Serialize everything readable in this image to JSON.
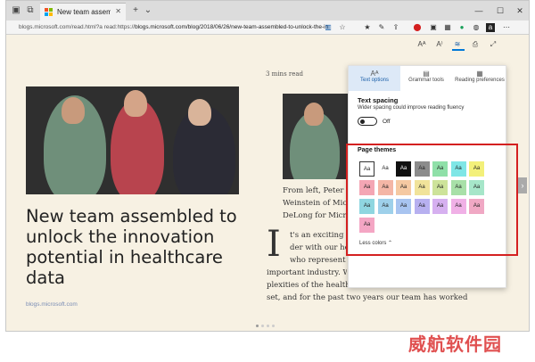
{
  "tab": {
    "title": "New team assembled to unlock"
  },
  "address": {
    "url_prefix": "blogs.microsoft.com/read.html?a",
    "read_label": "read:https://",
    "url_main": "blogs.microsoft.com/blog/2018/06/26/new-team-assembled-to-unlock-the-in"
  },
  "article": {
    "headline": "New team assembled to unlock the innovation potential in healthcare data",
    "source": "blogs.microsoft.com",
    "read_time": "3 mins read",
    "caption_lines": [
      "From left, Peter Le",
      "Weinstein of Micr",
      "DeLong for Micros"
    ],
    "drop_cap": "I",
    "body_lines": [
      "t's an exciting tim",
      "der with our heal",
      "who represent so",
      "important industry. We",
      "plexities of the health",
      "set, and for the past two years our team has worked"
    ]
  },
  "panel": {
    "tabs": [
      {
        "label": "Text options",
        "icon": "text-options-icon"
      },
      {
        "label": "Grammar tools",
        "icon": "grammar-tools-icon"
      },
      {
        "label": "Reading preferences",
        "icon": "reading-preferences-icon"
      }
    ],
    "text_spacing": {
      "title": "Text spacing",
      "desc": "Wider spacing could improve reading fluency",
      "state": "Off"
    },
    "themes": {
      "title": "Page themes",
      "swatch_label": "Aa",
      "less_label": "Less colors",
      "colors": [
        "#ffffff",
        "#ffffff",
        "#111111",
        "#8c8c8c",
        "#8fe0a8",
        "#7fe6e6",
        "#f3f07a",
        "#f4a6b4",
        "#f4b6a6",
        "#f5c9a2",
        "#f1e39a",
        "#cde39a",
        "#a8e0a8",
        "#a6e6c9",
        "#8fd6e0",
        "#9ed0ea",
        "#a8c4f0",
        "#b7b0f0",
        "#d6b0f0",
        "#f0b0e6",
        "#f0a8c4",
        "#f4a6c4"
      ],
      "dark_index": 2,
      "selected_index": 0
    }
  },
  "watermark": "威航软件园"
}
